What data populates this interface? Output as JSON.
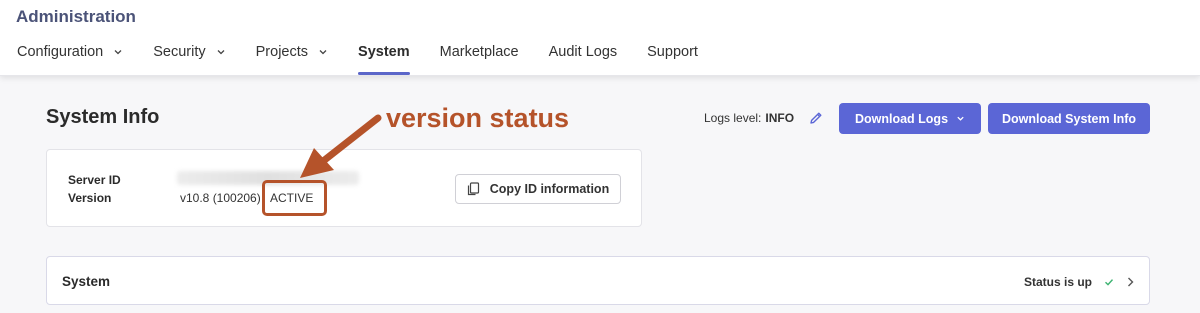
{
  "header": {
    "app_title": "Administration",
    "nav": [
      {
        "label": "Configuration",
        "has_dropdown": true
      },
      {
        "label": "Security",
        "has_dropdown": true
      },
      {
        "label": "Projects",
        "has_dropdown": true
      },
      {
        "label": "System",
        "active": true
      },
      {
        "label": "Marketplace"
      },
      {
        "label": "Audit Logs"
      },
      {
        "label": "Support"
      }
    ]
  },
  "main": {
    "page_title": "System Info",
    "logs_level": {
      "label": "Logs level:",
      "value": "INFO"
    },
    "download_logs_label": "Download Logs",
    "download_system_info_label": "Download System Info",
    "info_card": {
      "server_id_label": "Server ID",
      "version_label": "Version",
      "version_value": "v10.8 (100206)",
      "version_status": "ACTIVE",
      "copy_button_label": "Copy ID information"
    },
    "system_section": {
      "title": "System",
      "status_text": "Status is up"
    }
  },
  "annotation": {
    "text": "version status"
  },
  "colors": {
    "accent": "#5b66d6",
    "annotation": "#b5532a",
    "app_title": "#4b5378",
    "status_ok": "#3cb371"
  },
  "icons": [
    "chevron-down-icon",
    "pencil-icon",
    "copy-icon",
    "check-icon",
    "chevron-right-icon"
  ]
}
